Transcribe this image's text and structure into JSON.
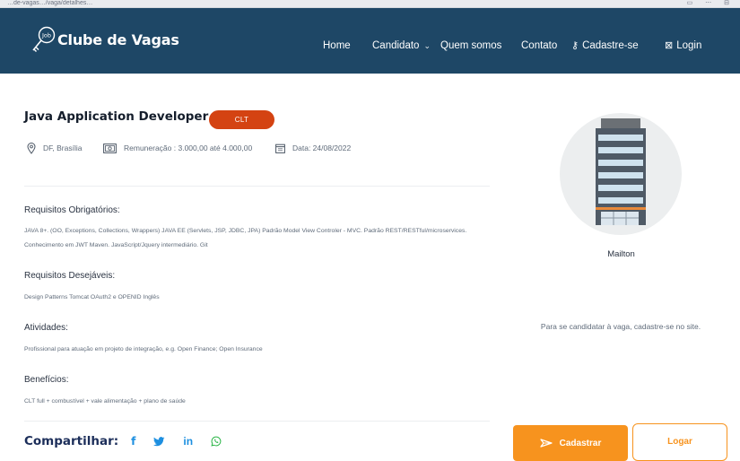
{
  "browser": {
    "url_fragment": "…de-vagas…/vaga/detalhes…"
  },
  "brand": {
    "logo_label": "Job",
    "name": "Clube de Vagas"
  },
  "nav": {
    "home": "Home",
    "candidato": "Candidato",
    "quem_somos": "Quem somos",
    "contato": "Contato",
    "cadastre": "Cadastre-se",
    "login": "Login"
  },
  "job": {
    "title": "Java Application Developer",
    "badge": "CLT",
    "location": "DF, Brasília",
    "salary": "Remuneração : 3.000,00 até 4.000,00",
    "date": "Data: 24/08/2022"
  },
  "sections": {
    "req_obr": {
      "heading": "Requisitos Obrigatórios:",
      "text": "JAVA 8+. (OO, Exceptions, Collections, Wrappers) JAVA EE (Servlets, JSP, JDBC, JPA) Padrão Model View Controler - MVC. Padrão REST/RESTful/microservices. Conhecimento em JWT Maven. JavaScript/Jquery intermediário. Git"
    },
    "req_des": {
      "heading": "Requisitos Desejáveis:",
      "text": "Design Patterns Tomcat OAuth2 e OPENID Inglês"
    },
    "atividades": {
      "heading": "Atividades:",
      "text": "Profissional para atuação em projeto de integração, e.g. Open Finance; Open Insurance"
    },
    "beneficios": {
      "heading": "Benefícios:",
      "text": "CLT full + combustível + vale alimentação + plano de saúde"
    }
  },
  "share": {
    "label": "Compartilhar:",
    "icons": [
      "facebook-icon",
      "twitter-icon",
      "linkedin-icon",
      "whatsapp-icon"
    ],
    "facebook": "f",
    "linkedin": "in"
  },
  "sidebar": {
    "company": "Mailton",
    "apply_msg": "Para se candidatar à vaga, cadastre-se no site.",
    "cadastrar": "Cadastrar",
    "logar": "Logar"
  },
  "colors": {
    "navbar": "#1e4766",
    "badge": "#d44312",
    "accent_orange": "#f7931e",
    "social_blue": "#1d8fe0",
    "whatsapp_green": "#25b342"
  }
}
